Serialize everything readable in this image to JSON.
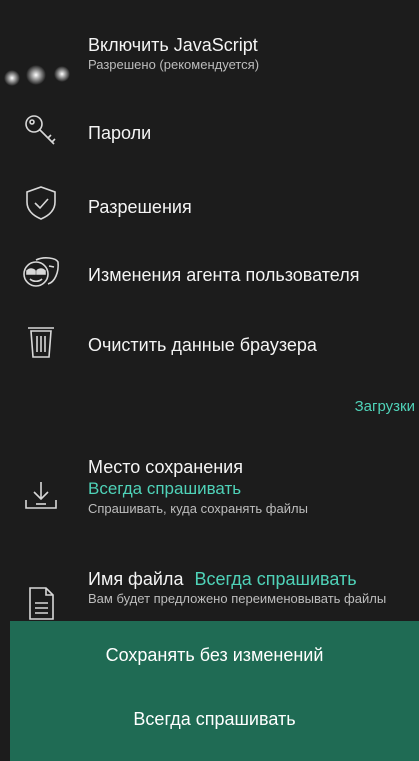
{
  "settings": {
    "javascript": {
      "title": "Включить JavaScript",
      "subtitle": "Разрешено (рекомендуется)"
    },
    "passwords": {
      "title": "Пароли"
    },
    "permissions": {
      "title": "Разрешения"
    },
    "user_agent": {
      "title": "Изменения агента пользователя"
    },
    "clear_data": {
      "title": "Очистить данные браузера"
    }
  },
  "downloads_section": {
    "label": "Загрузки",
    "save_location": {
      "title": "Место сохранения",
      "value": "Всегда спрашивать",
      "description": "Спрашивать, куда сохранять файлы"
    },
    "file_name": {
      "title": "Имя файла",
      "value": "Всегда спрашивать",
      "description": "Вам будет предложено переименовывать файлы"
    }
  },
  "bottom_sheet": {
    "options": [
      "Сохранять без изменений",
      "Всегда спрашивать"
    ]
  },
  "colors": {
    "background": "#1c1c1c",
    "accent": "#4fd2b8",
    "sheet": "#1f6b54"
  }
}
